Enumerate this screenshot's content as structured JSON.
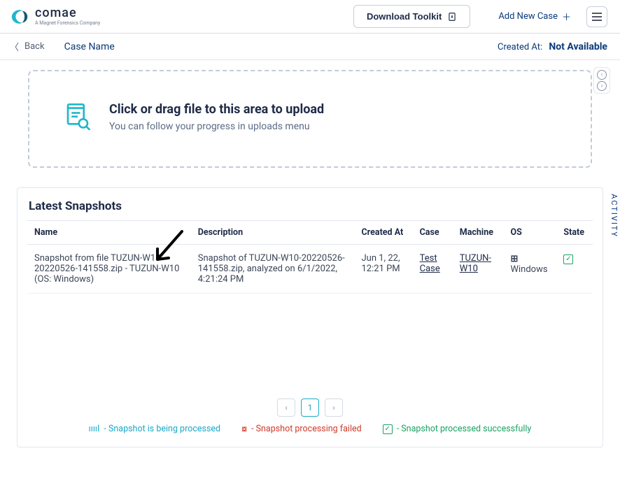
{
  "header": {
    "brand": "comae",
    "brand_sub": "A Magnet Forensics Company",
    "download_label": "Download Toolkit",
    "add_new_label": "Add New Case"
  },
  "subheader": {
    "back_label": "Back",
    "case_name_label": "Case Name",
    "created_at_label": "Created At:",
    "created_at_value": "Not Available"
  },
  "upload": {
    "title": "Click or drag file to this area to upload",
    "subtitle": "You can follow your progress in uploads menu"
  },
  "snapshots": {
    "title": "Latest Snapshots",
    "columns": {
      "name": "Name",
      "description": "Description",
      "created_at": "Created At",
      "case": "Case",
      "machine": "Machine",
      "os": "OS",
      "state": "State"
    },
    "rows": [
      {
        "name": "Snapshot from file TUZUN-W10-20220526-141558.zip - TUZUN-W10 (OS: Windows)",
        "description": "Snapshot of TUZUN-W10-20220526-141558.zip, analyzed on 6/1/2022, 4:21:24 PM",
        "created_at": "Jun 1, 22, 12:21 PM",
        "case": "Test Case",
        "machine": "TUZUN-W10",
        "os": "Windows",
        "state": "ok"
      }
    ]
  },
  "pagination": {
    "prev": "‹",
    "current": "1",
    "next": "›"
  },
  "legend": {
    "processing": "- Snapshot is being processed",
    "failed": "- Snapshot processing failed",
    "ok": "- Snapshot processed successfully"
  },
  "side": {
    "activity": "ACTIVITY"
  }
}
